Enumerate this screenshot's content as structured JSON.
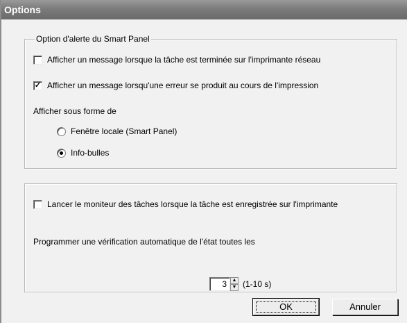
{
  "window": {
    "title": "Options"
  },
  "alert_group": {
    "legend": "Option d'alerte du Smart Panel",
    "network_message": {
      "label": "Afficher un message lorsque la tâche est terminée sur l'imprimante réseau",
      "checked": false
    },
    "error_message": {
      "label": "Afficher un message lorsqu'une erreur se produit au cours de l'impression",
      "checked": true
    },
    "display_as_label": "Afficher sous forme de",
    "radio_local": {
      "label": "Fenêtre locale (Smart Panel)",
      "checked": false
    },
    "radio_tooltip": {
      "label": "Info-bulles",
      "checked": true
    }
  },
  "monitor_group": {
    "launch_monitor": {
      "label": "Lancer le moniteur des tâches lorsque la tâche est enregistrée sur l'imprimante",
      "checked": false
    },
    "schedule_label": "Programmer une vérification automatique de l'état toutes les",
    "interval_value": "3",
    "interval_unit": "(1-10 s)"
  },
  "buttons": {
    "ok": "OK",
    "cancel": "Annuler"
  }
}
